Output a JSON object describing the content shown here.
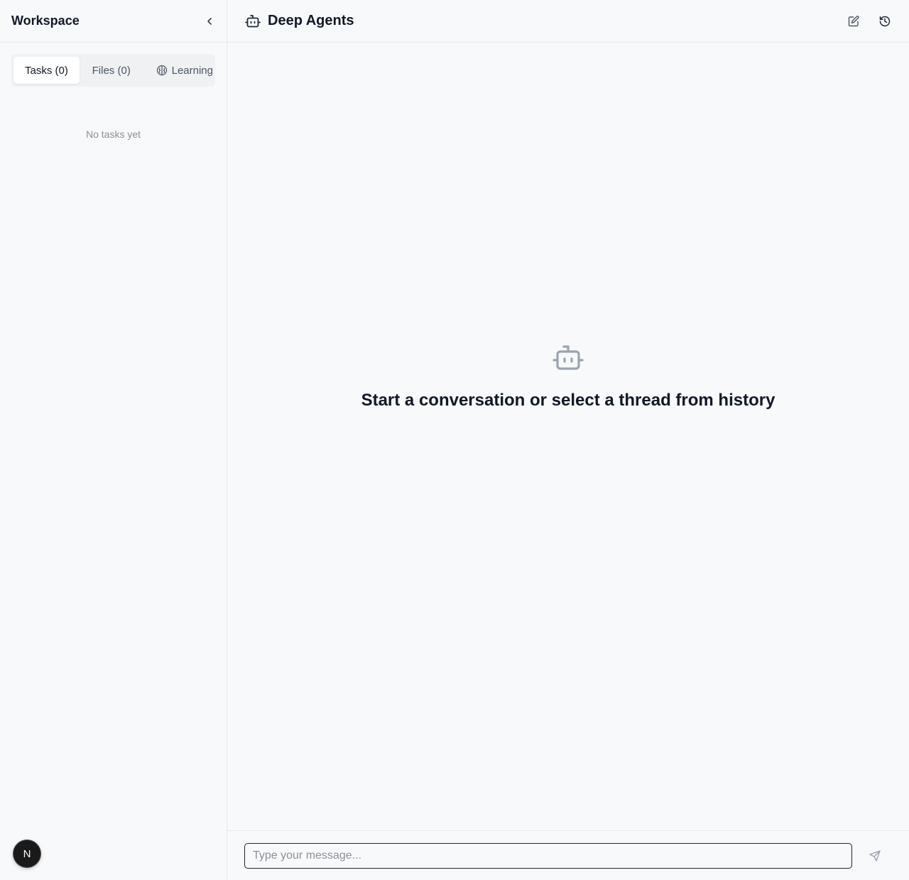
{
  "sidebar": {
    "title": "Workspace",
    "tabs": [
      {
        "label": "Tasks (0)"
      },
      {
        "label": "Files (0)"
      },
      {
        "label": "Learning"
      }
    ],
    "empty_text": "No tasks yet",
    "avatar_initial": "N"
  },
  "main": {
    "title": "Deep Agents",
    "empty_heading": "Start a conversation or select a thread from history",
    "composer": {
      "placeholder": "Type your message..."
    }
  },
  "icons": {
    "collapse": "chevron-left-icon",
    "agent": "bot-icon",
    "new_thread": "edit-icon",
    "history": "history-icon",
    "learning": "brain-icon",
    "send": "send-icon"
  }
}
